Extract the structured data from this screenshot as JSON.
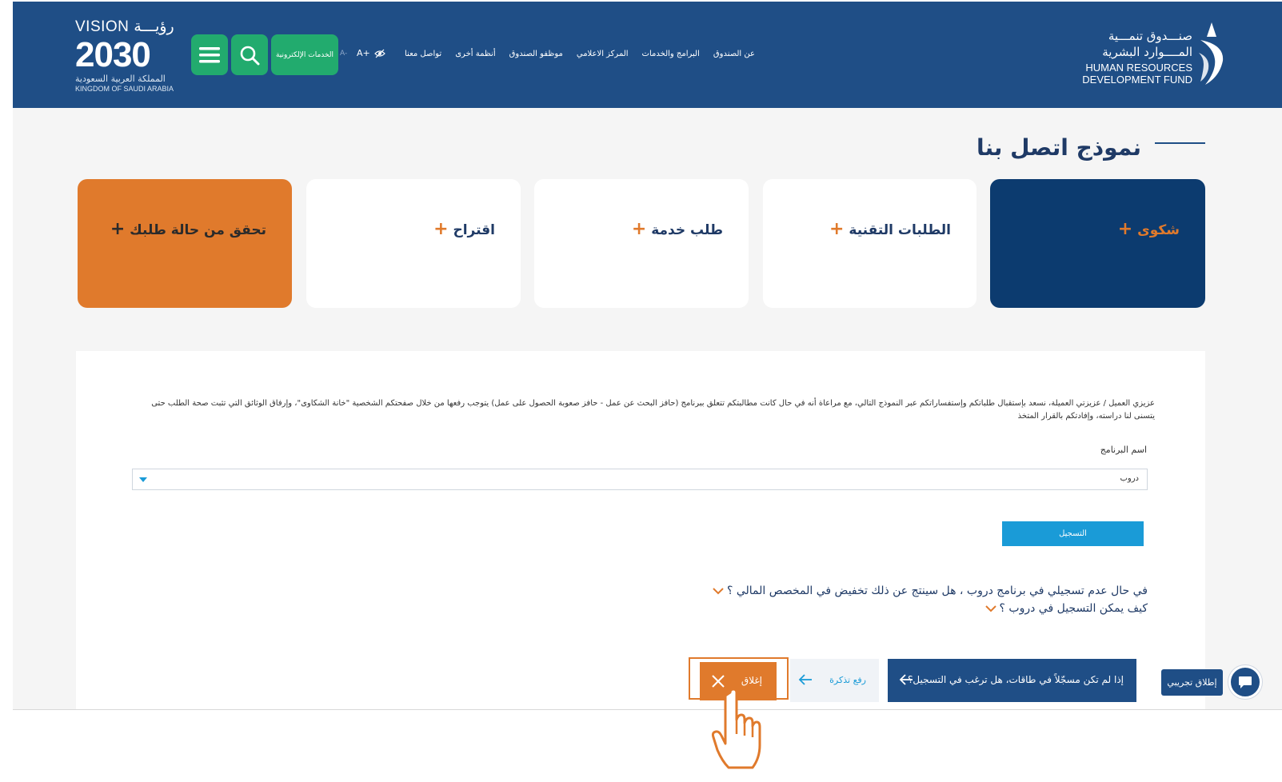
{
  "header": {
    "vision_top": "VISION رؤيـــة",
    "vision_year": "2030",
    "vision_ar": "المملكة العربية السعودية",
    "vision_en": "KINGDOM OF SAUDI ARABIA",
    "eservices_label": "الخدمات الإلكترونية",
    "font_smaller": "A-",
    "font_larger": "A+",
    "nav": [
      "عن الصندوق",
      "البرامج والخدمات",
      "المركز الاعلامي",
      "موظفو الصندوق",
      "أنظمة أخرى",
      "تواصل معنا"
    ],
    "fund_ar_line1": "صنـــدوق تنمـــية",
    "fund_ar_line2": "المــــوارد البشرية",
    "fund_en_line1": "HUMAN RESOURCES",
    "fund_en_line2": "DEVELOPMENT FUND",
    "brand_color": "#1f4e86",
    "green": "#22ab6e"
  },
  "page": {
    "title": "نموذج اتصل بنا"
  },
  "cards": {
    "complaint": "شكوى",
    "tech_requests": "الطلبات التقنية",
    "service_request": "طلب خدمة",
    "suggestion": "اقتراح",
    "check_status": "تحقق من حالة طلبك",
    "plus": "+"
  },
  "form": {
    "intro": "عزيزي العميل / عزيزتي العميلة، نسعد بإستقبال طلباتكم وإستفساراتكم عبر النموذج التالي، مع مراعاة أنه في حال كانت مطالبتكم تتعلق ببرنامج (حافز البحث عن عمل - حافز صعوبة الحصول على عمل) يتوجب رفعها من خلال صفحتكم الشخصية \"خانة الشكاوى\"، وإرفاق الوثائق التي تثبت صحة الطلب حتى يتسنى لنا دراسته، وإفادتكم بالقرار المتخذ",
    "program_label": "اسم البرنامج",
    "program_value": "دروب",
    "register_label": "التسجيل",
    "faq1": "في حال عدم تسجيلي في برنامج دروب ، هل سينتج عن ذلك تخفيض في المخصص المالي ؟",
    "faq2": "كيف يمكن التسجيل في دروب ؟"
  },
  "chat": {
    "question": "إذا لم تكن مسجّلاً في طاقات، هل ترغب في التسجيل؟",
    "upload_ticket": "رفع تذكرة",
    "close": "إغلاق",
    "beta": "إطلاق تجريبي",
    "accent": "#e07a2c"
  }
}
